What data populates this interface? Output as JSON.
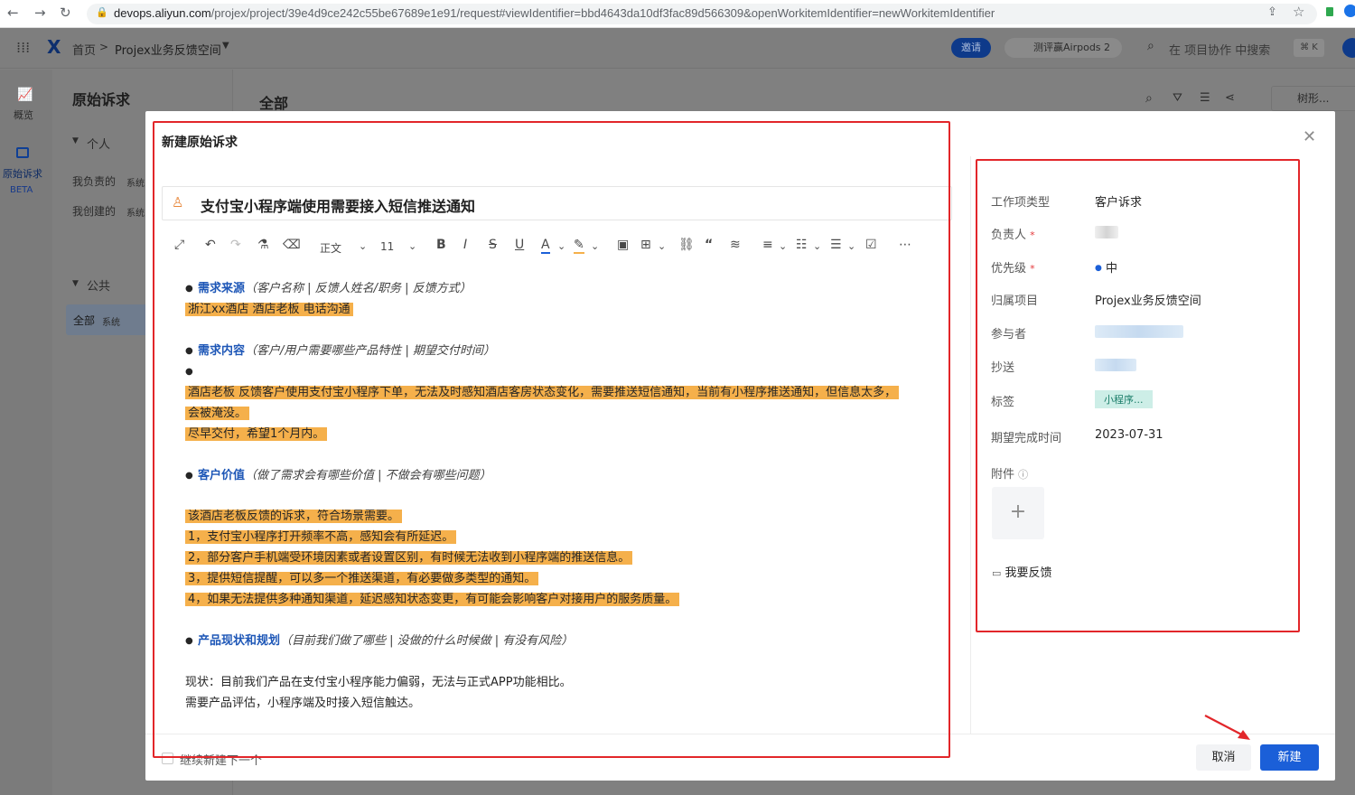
{
  "browser": {
    "back": "←",
    "forward": "→",
    "reload": "↻",
    "url_host": "devops.aliyun.com",
    "url_path": "/projex/project/39e4d9ce242c55be67689e1e91/request#viewIdentifier=bbd4643da10df3fac89d566309&openWorkitemIdentifier=newWorkitemIdentifier"
  },
  "topbar": {
    "home": "首页",
    "separator": ">",
    "space": "Projex业务反馈空间",
    "invite": "邀请",
    "promo": "测评赢Airpods 2",
    "search_placeholder": "在 项目协作 中搜索",
    "shortcut": "⌘ K"
  },
  "leftnav": {
    "overview": "概览",
    "requests": "原始诉求",
    "beta": "BETA"
  },
  "panel": {
    "title": "原始诉求",
    "personal": "个人",
    "mine_assigned": "我负责的",
    "mine_created": "我创建的",
    "sys_tag": "系统",
    "public": "公共",
    "all": "全部"
  },
  "main": {
    "title": "全部",
    "view_select": "树形..."
  },
  "modal": {
    "title": "新建原始诉求",
    "item_title": "支付宝小程序端使用需要接入短信推送通知",
    "toolbar": {
      "style": "正文",
      "size": "11"
    },
    "editor": {
      "s1_head": "需求来源",
      "s1_hint": "（客户名称 | 反馈人姓名/职务 | 反馈方式）",
      "s1_body": "浙江xx酒店   酒店老板  电话沟通",
      "s2_head": "需求内容",
      "s2_hint": "（客户/用户需要哪些产品特性 | 期望交付时间）",
      "s2_body1": "酒店老板 反馈客户使用支付宝小程序下单，无法及时感知酒店客房状态变化，需要推送短信通知，当前有小程序推送通知，但信息太多，",
      "s2_body2": "会被淹没。",
      "s2_body3": "尽早交付，希望1个月内。",
      "s3_head": "客户价值",
      "s3_hint": "（做了需求会有哪些价值 | 不做会有哪些问题）",
      "s3_l1": "该酒店老板反馈的诉求，符合场景需要。",
      "s3_l2": "1，支付宝小程序打开频率不高，感知会有所延迟。",
      "s3_l3": "2，部分客户手机端受环境因素或者设置区别，有时候无法收到小程序端的推送信息。",
      "s3_l4": "3，提供短信提醒，可以多一个推送渠道，有必要做多类型的通知。",
      "s3_l5": "4，如果无法提供多种通知渠道，延迟感知状态变更，有可能会影响客户对接用户的服务质量。",
      "s4_head": "产品现状和规划",
      "s4_hint": "（目前我们做了哪些 | 没做的什么时候做 | 有没有风险）",
      "s4_l1": "现状：目前我们产品在支付宝小程序能力偏弱，无法与正式APP功能相比。",
      "s4_l2": "需要产品评估，小程序端及时接入短信触达。"
    },
    "props": {
      "type_label": "工作项类型",
      "type_value": "客户诉求",
      "owner_label": "负责人",
      "priority_label": "优先级",
      "priority_value": "中",
      "project_label": "归属项目",
      "project_value": "Projex业务反馈空间",
      "participants_label": "参与者",
      "cc_label": "抄送",
      "tags_label": "标签",
      "tag_value": "小程序...",
      "due_label": "期望完成时间",
      "due_value": "2023-07-31",
      "attach_label": "附件",
      "required_mark": "*",
      "feedback": "我要反馈"
    },
    "footer": {
      "continue": "继续新建下一个",
      "cancel": "取消",
      "create": "新建"
    }
  },
  "colors": {
    "primary": "#1b5fd8",
    "highlight": "#f5b04b",
    "link_blue": "#1e57b7",
    "annotation_red": "#e2262a"
  }
}
